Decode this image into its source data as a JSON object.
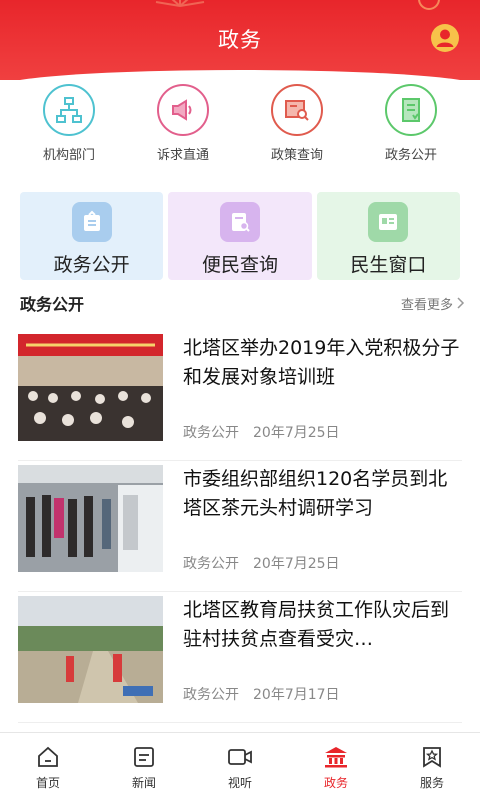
{
  "header": {
    "title": "政务"
  },
  "quick_entries": [
    {
      "label": "机构部门",
      "icon": "org-chart-icon",
      "color": "#4ec2d0"
    },
    {
      "label": "诉求直通",
      "icon": "megaphone-icon",
      "color": "#e25f8c"
    },
    {
      "label": "政策查询",
      "icon": "policy-search-icon",
      "color": "#e05b4e"
    },
    {
      "label": "政务公开",
      "icon": "document-icon",
      "color": "#5cc86b"
    }
  ],
  "cards": [
    {
      "label": "政务公开",
      "bg": "#e3f0fb",
      "icon_bg": "#a9cdee"
    },
    {
      "label": "便民查询",
      "bg": "#f3e7fa",
      "icon_bg": "#d7b4ee"
    },
    {
      "label": "民生窗口",
      "bg": "#e5f6e7",
      "icon_bg": "#9fd9a8"
    }
  ],
  "section": {
    "title": "政务公开",
    "more": "查看更多"
  },
  "news": [
    {
      "title": "北塔区举办2019年入党积极分子和发展对象培训班",
      "source": "政务公开",
      "date": "20年7月25日"
    },
    {
      "title": "市委组织部组织120名学员到北塔区茶元头村调研学习",
      "source": "政务公开",
      "date": "20年7月25日"
    },
    {
      "title": "北塔区教育局扶贫工作队灾后到驻村扶贫点查看受灾…",
      "source": "政务公开",
      "date": "20年7月17日"
    }
  ],
  "tabs": [
    {
      "label": "首页",
      "icon": "home-icon"
    },
    {
      "label": "新闻",
      "icon": "news-icon"
    },
    {
      "label": "视听",
      "icon": "video-icon"
    },
    {
      "label": "政务",
      "icon": "government-icon",
      "active": true
    },
    {
      "label": "服务",
      "icon": "service-icon"
    }
  ],
  "colors": {
    "primary": "#e8262b"
  }
}
